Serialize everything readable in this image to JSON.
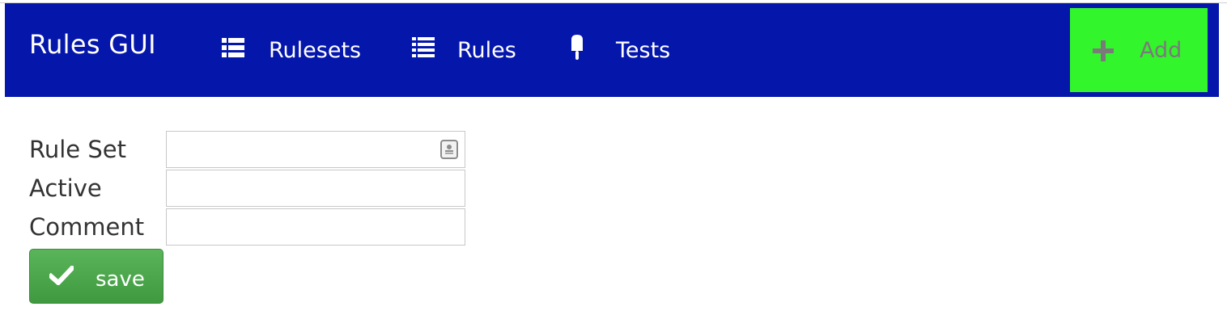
{
  "navbar": {
    "brand": "Rules GUI",
    "items": [
      {
        "label": "Rulesets",
        "icon": "list-icon"
      },
      {
        "label": "Rules",
        "icon": "list-icon"
      },
      {
        "label": "Tests",
        "icon": "popsicle-icon"
      }
    ],
    "add_button": {
      "label": "Add",
      "icon": "plus-icon"
    }
  },
  "form": {
    "fields": [
      {
        "label": "Rule Set",
        "value": ""
      },
      {
        "label": "Active",
        "value": ""
      },
      {
        "label": "Comment",
        "value": ""
      }
    ],
    "save_button": {
      "label": "save",
      "icon": "checkmark-icon"
    }
  },
  "colors": {
    "navbar_bg": "#0516ab",
    "add_button_bg": "#33f52b",
    "save_button_bg": "#4aa84a"
  }
}
